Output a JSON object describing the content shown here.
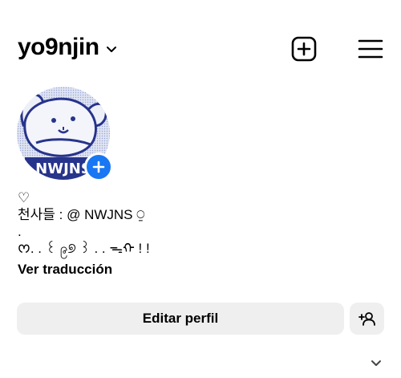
{
  "header": {
    "username": "yo9njin",
    "dropdown_icon": "chevron-down-icon",
    "create_icon": "plus-square-icon",
    "menu_icon": "hamburger-menu-icon"
  },
  "profile": {
    "avatar_text": "NWJNS",
    "add_story_icon": "plus-circle-icon",
    "brand_blue": "#1877f2"
  },
  "bio": {
    "line1": "♡",
    "line2": "천사들 : @ NWJNS ⍜",
    "line3": ".",
    "line4": "ᰔ. . ꒰ ၉୭ ꒱ . . ᯓᡣ ! !",
    "translate": "Ver traducción"
  },
  "actions": {
    "edit_profile": "Editar perfil",
    "add_friend_icon": "add-person-icon",
    "expand_icon": "chevron-down-icon"
  }
}
